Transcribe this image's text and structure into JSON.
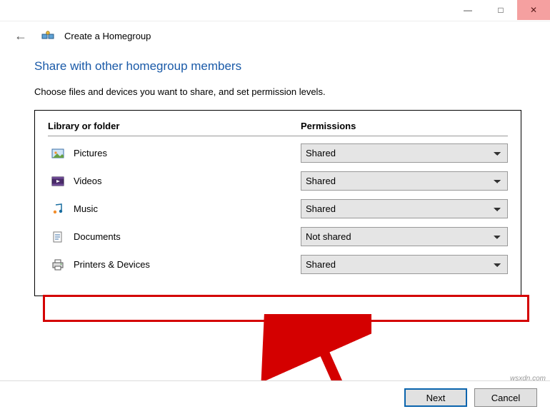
{
  "window": {
    "title": "Create a Homegroup"
  },
  "heading": "Share with other homegroup members",
  "subtext": "Choose files and devices you want to share, and set permission levels.",
  "columns": {
    "library": "Library or folder",
    "permissions": "Permissions"
  },
  "rows": [
    {
      "key": "pictures",
      "label": "Pictures",
      "value": "Shared"
    },
    {
      "key": "videos",
      "label": "Videos",
      "value": "Shared"
    },
    {
      "key": "music",
      "label": "Music",
      "value": "Shared"
    },
    {
      "key": "documents",
      "label": "Documents",
      "value": "Not shared"
    },
    {
      "key": "printers",
      "label": "Printers & Devices",
      "value": "Shared"
    }
  ],
  "options": [
    "Shared",
    "Not shared"
  ],
  "buttons": {
    "next": "Next",
    "cancel": "Cancel"
  },
  "watermark": "wsxdn.com"
}
